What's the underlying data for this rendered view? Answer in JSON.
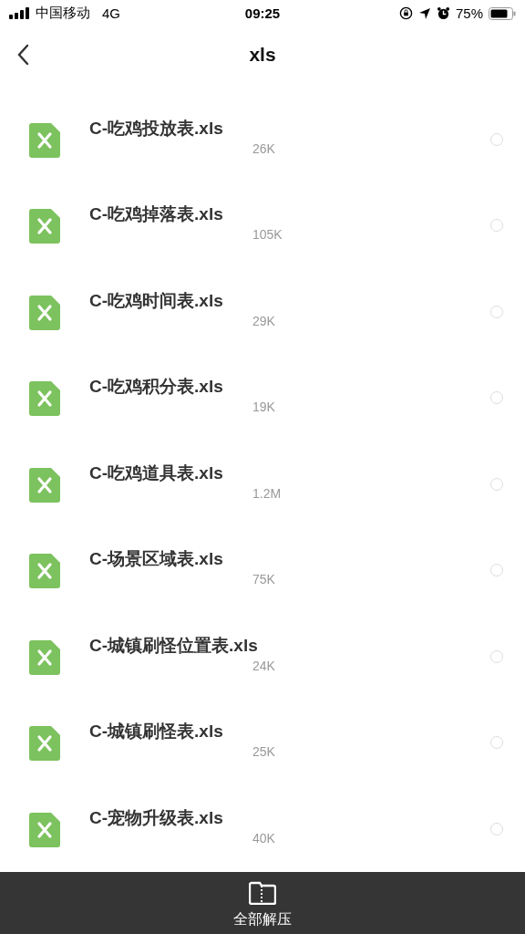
{
  "status_bar": {
    "carrier": "中国移动",
    "network": "4G",
    "time": "09:25",
    "battery": "75%"
  },
  "nav": {
    "title": "xls"
  },
  "files": [
    {
      "name": "C-吃鸡投放表.xls",
      "size": "26K",
      "selected": false
    },
    {
      "name": "C-吃鸡掉落表.xls",
      "size": "105K",
      "selected": false
    },
    {
      "name": "C-吃鸡时间表.xls",
      "size": "29K",
      "selected": false
    },
    {
      "name": "C-吃鸡积分表.xls",
      "size": "19K",
      "selected": false
    },
    {
      "name": "C-吃鸡道具表.xls",
      "size": "1.2M",
      "selected": false
    },
    {
      "name": "C-场景区域表.xls",
      "size": "75K",
      "selected": false
    },
    {
      "name": "C-城镇刷怪位置表.xls",
      "size": "24K",
      "selected": false
    },
    {
      "name": "C-城镇刷怪表.xls",
      "size": "25K",
      "selected": false
    },
    {
      "name": "C-宠物升级表.xls",
      "size": "40K",
      "selected": false
    }
  ],
  "bottom_bar": {
    "action": "全部解压"
  }
}
